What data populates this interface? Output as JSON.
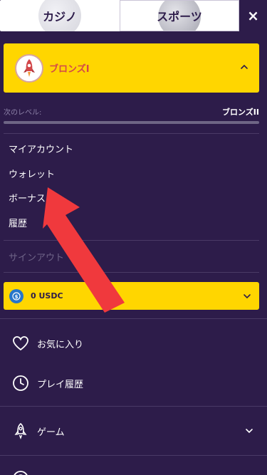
{
  "tabs": {
    "casino": "カジノ",
    "sports": "スポーツ",
    "close": "×"
  },
  "level": {
    "current": "ブロンズI",
    "next_label": "次のレベル:",
    "next_value": "ブロンズII",
    "progress": 0.0
  },
  "account_menu": [
    {
      "label": "マイアカウント"
    },
    {
      "label": "ウォレット"
    },
    {
      "label": "ボーナス"
    },
    {
      "label": "履歴"
    }
  ],
  "signout": "サインアウト",
  "wallet": {
    "amount": "0 USDC"
  },
  "nav": [
    {
      "label": "お気に入り",
      "icon": "heart-icon"
    },
    {
      "label": "プレイ履歴",
      "icon": "clock-icon"
    },
    {
      "label": "ゲーム",
      "icon": "rocket-icon"
    }
  ],
  "colors": {
    "background": "#2d1c4a",
    "accent": "#ffd600",
    "level_text": "#d2474a",
    "annotation_arrow": "#f0393d"
  }
}
